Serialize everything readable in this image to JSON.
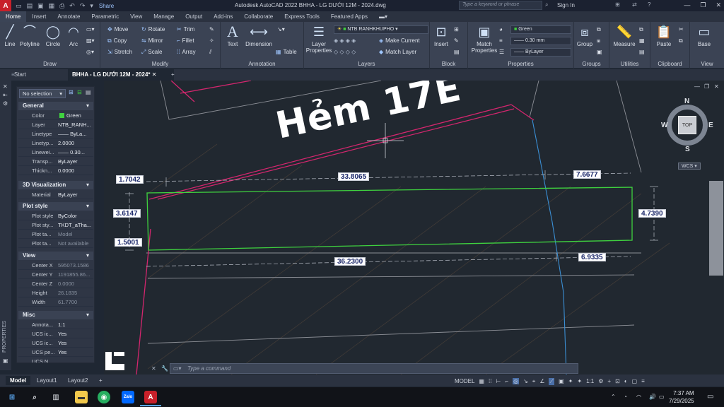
{
  "titlebar": {
    "logo": "A",
    "share": "Share",
    "app_title": "Autodesk AutoCAD 2022    BHHA - LG DƯỚI 12M - 2024.dwg",
    "search_placeholder": "Type a keyword or phrase",
    "sign_in": "Sign In"
  },
  "ribbon_tabs": [
    "Home",
    "Insert",
    "Annotate",
    "Parametric",
    "View",
    "Manage",
    "Output",
    "Add-ins",
    "Collaborate",
    "Express Tools",
    "Featured Apps"
  ],
  "ribbon": {
    "draw": {
      "title": "Draw",
      "line": "Line",
      "polyline": "Polyline",
      "circle": "Circle",
      "arc": "Arc"
    },
    "modify": {
      "title": "Modify",
      "move": "Move",
      "rotate": "Rotate",
      "trim": "Trim",
      "copy": "Copy",
      "mirror": "Mirror",
      "fillet": "Fillet",
      "stretch": "Stretch",
      "scale": "Scale",
      "array": "Array"
    },
    "annotation": {
      "title": "Annotation",
      "text": "Text",
      "dimension": "Dimension",
      "table": "Table"
    },
    "layers": {
      "title": "Layers",
      "layer_properties": "Layer Properties",
      "layer_combo": "NTB RANHKHUPHO",
      "make_current": "Make Current",
      "match_layer": "Match Layer"
    },
    "block": {
      "title": "Block",
      "insert": "Insert"
    },
    "properties": {
      "title": "Properties",
      "match_properties": "Match Properties",
      "color": "Green",
      "lineweight": "0.30 mm",
      "linetype": "ByLayer"
    },
    "groups": {
      "title": "Groups",
      "group": "Group"
    },
    "utilities": {
      "title": "Utilities",
      "measure": "Measure"
    },
    "clipboard": {
      "title": "Clipboard",
      "paste": "Paste"
    },
    "view": {
      "title": "View",
      "base": "Base"
    }
  },
  "doc_tabs": {
    "start": "Start",
    "active": "BHHA - LG DƯỚI 12M - 2024*"
  },
  "properties_panel": {
    "selection": "No selection",
    "general_title": "General",
    "general": [
      {
        "k": "Color",
        "v": "Green"
      },
      {
        "k": "Layer",
        "v": "NTB_RANH..."
      },
      {
        "k": "Linetype",
        "v": "—— ByLa..."
      },
      {
        "k": "Linetyp...",
        "v": "2.0000"
      },
      {
        "k": "Linewei...",
        "v": "—— 0.30..."
      },
      {
        "k": "Transp...",
        "v": "ByLayer"
      },
      {
        "k": "Thickn...",
        "v": "0.0000"
      }
    ],
    "viz_title": "3D Visualization",
    "viz": [
      {
        "k": "Material",
        "v": "ByLayer"
      }
    ],
    "plot_title": "Plot style",
    "plot": [
      {
        "k": "Plot style",
        "v": "ByColor"
      },
      {
        "k": "Plot sty...",
        "v": "TKDT_aTha..."
      },
      {
        "k": "Plot ta...",
        "v": "Model"
      },
      {
        "k": "Plot ta...",
        "v": "Not available"
      }
    ],
    "view_title": "View",
    "view": [
      {
        "k": "Center X",
        "v": "595073.1586"
      },
      {
        "k": "Center Y",
        "v": "1191855.86..."
      },
      {
        "k": "Center Z",
        "v": "0.0000"
      },
      {
        "k": "Height",
        "v": "26.1835"
      },
      {
        "k": "Width",
        "v": "61.7700"
      }
    ],
    "misc_title": "Misc",
    "misc": [
      {
        "k": "Annota...",
        "v": "1:1"
      },
      {
        "k": "UCS ic...",
        "v": "Yes"
      },
      {
        "k": "UCS ic...",
        "v": "Yes"
      },
      {
        "k": "UCS pe...",
        "v": "Yes"
      },
      {
        "k": "UCS N...",
        "v": ""
      }
    ],
    "strip_label": "PROPERTIES"
  },
  "drawing": {
    "street_label": "Hẻm 17E",
    "dims": {
      "top_left": "1.7042",
      "top_mid": "33.8065",
      "top_right": "7.6677",
      "left_upper": "3.6147",
      "right": "4.7390",
      "left_lower": "1.5001",
      "bottom_mid": "36.2300",
      "bottom_right": "6.9335"
    },
    "viewcube": {
      "n": "N",
      "s": "S",
      "e": "E",
      "w": "W",
      "top": "TOP",
      "wcs": "WCS"
    }
  },
  "command_line": {
    "placeholder": "Type a command"
  },
  "layout_tabs": [
    "Model",
    "Layout1",
    "Layout2"
  ],
  "status": {
    "model": "MODEL",
    "scale": "1:1"
  },
  "clock": {
    "time": "7:37 AM",
    "date": "7/29/2025"
  },
  "colors": {
    "green_boundary": "#3fd23f",
    "magenta": "#d4266e",
    "cyan": "#3b8fd4",
    "bg": "#212830"
  }
}
